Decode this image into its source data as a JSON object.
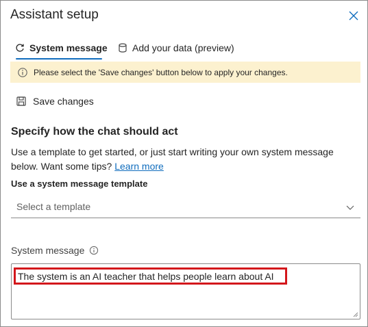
{
  "header": {
    "title": "Assistant setup"
  },
  "tabs": [
    {
      "label": "System message",
      "icon": "refresh-icon",
      "selected": true
    },
    {
      "label": "Add your data (preview)",
      "icon": "database-icon",
      "selected": false
    }
  ],
  "notice": {
    "text": "Please select the 'Save changes' button below to apply your changes.",
    "icon": "info-icon",
    "background": "#fcf1cf"
  },
  "toolbar": {
    "save_label": "Save changes",
    "save_icon": "save-icon"
  },
  "section": {
    "heading": "Specify how the chat should act",
    "description": "Use a template to get started, or just start writing your own system message below. Want some tips? ",
    "learn_more": "Learn more"
  },
  "template": {
    "label": "Use a system message template",
    "placeholder": "Select a template"
  },
  "system_message": {
    "label": "System message",
    "value": "The system is an AI teacher that helps people learn about AI"
  },
  "colors": {
    "accent": "#0f6cbd",
    "highlight": "#d3161b"
  }
}
